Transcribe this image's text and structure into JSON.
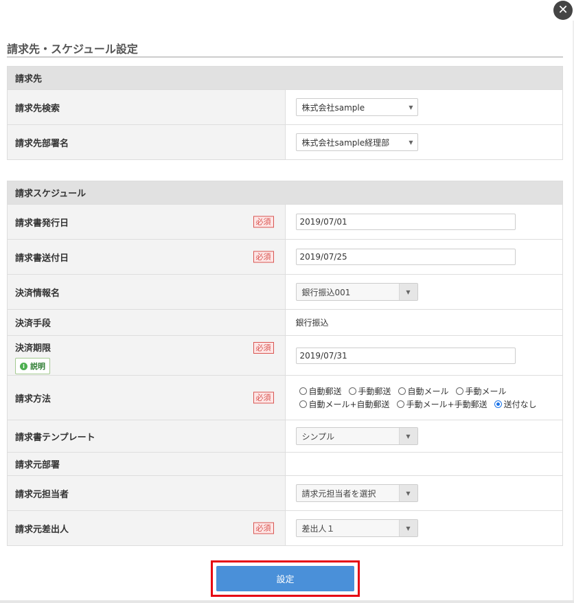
{
  "modal": {
    "title": "請求先・スケジュール設定",
    "close_icon": "close-icon"
  },
  "billing_section": {
    "heading": "請求先",
    "search_label": "請求先検索",
    "search_value": "株式会社sample",
    "dept_label": "請求先部署名",
    "dept_value": "株式会社sample経理部"
  },
  "schedule_section": {
    "heading": "請求スケジュール",
    "required_badge": "必須",
    "issue_date_label": "請求書発行日",
    "issue_date_value": "2019/07/01",
    "send_date_label": "請求書送付日",
    "send_date_value": "2019/07/25",
    "payment_info_label": "決済情報名",
    "payment_info_value": "銀行振込001",
    "payment_method_label": "決済手段",
    "payment_method_value": "銀行振込",
    "due_date_label": "決済期限",
    "due_date_help": "説明",
    "due_date_value": "2019/07/31",
    "billing_method_label": "請求方法",
    "billing_methods": [
      "自動郵送",
      "手動郵送",
      "自動メール",
      "手動メール",
      "自動メール+自動郵送",
      "手動メール+手動郵送",
      "送付なし"
    ],
    "billing_method_selected": "送付なし",
    "template_label": "請求書テンプレート",
    "template_value": "シンプル",
    "issuer_dept_label": "請求元部署",
    "issuer_dept_value": "",
    "issuer_person_label": "請求元担当者",
    "issuer_person_value": "請求元担当者を選択",
    "sender_label": "請求元差出人",
    "sender_value": "差出人１"
  },
  "actions": {
    "submit_label": "設定"
  },
  "colors": {
    "submit_bg": "#4a90d9",
    "highlight_border": "#e60012",
    "required_color": "#d9534f"
  }
}
